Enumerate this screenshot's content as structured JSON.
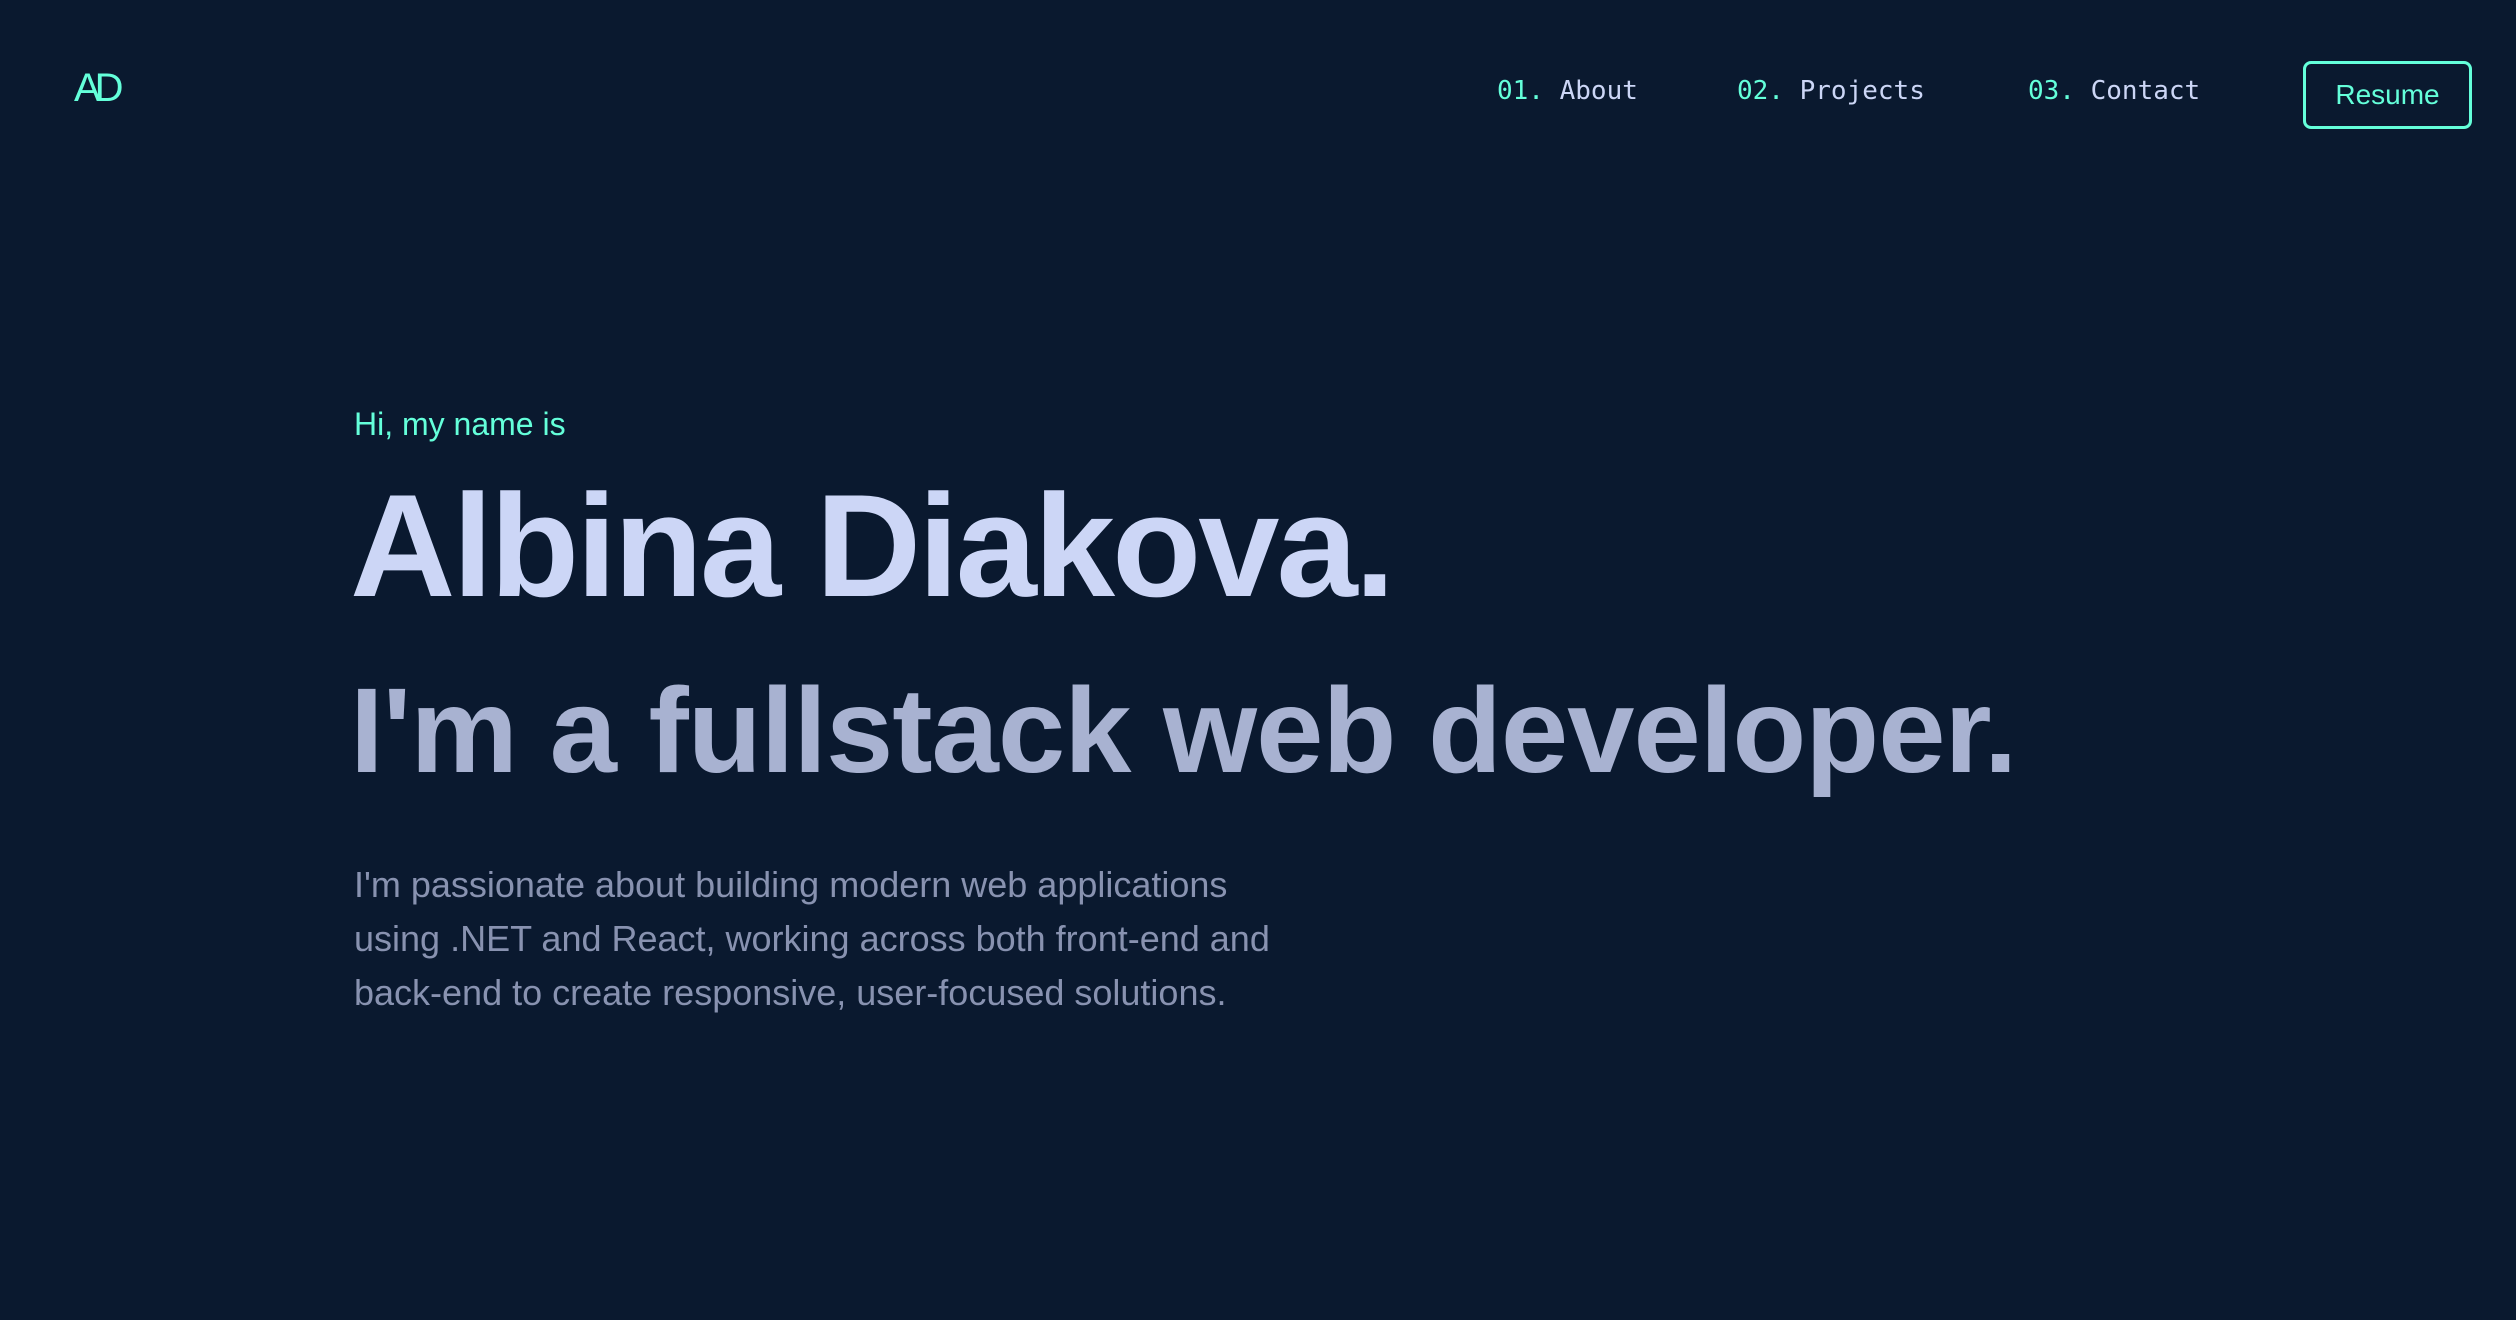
{
  "header": {
    "logo": "AD",
    "nav": [
      {
        "num": "01.",
        "label": "About"
      },
      {
        "num": "02.",
        "label": "Projects"
      },
      {
        "num": "03.",
        "label": "Contact"
      }
    ],
    "resume_label": "Resume"
  },
  "hero": {
    "greeting": "Hi, my name is",
    "name": "Albina Diakova.",
    "tagline": "I'm a fullstack web developer.",
    "description_lines": [
      "I'm passionate about building modern web applications",
      "using .NET and React, working across both front-end and",
      "back-end to create responsive, user-focused solutions."
    ]
  },
  "colors": {
    "background": "#0a192f",
    "accent": "#64ffda",
    "heading": "#ccd6f6",
    "subheading": "#a8b2d1",
    "body": "#8892b0"
  }
}
